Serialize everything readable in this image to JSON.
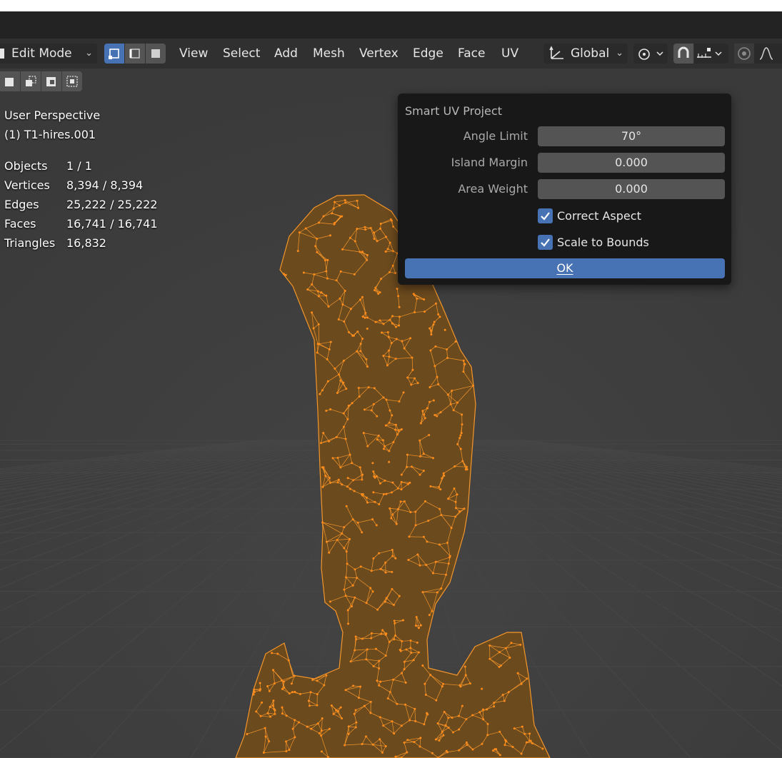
{
  "header": {
    "mode": "Edit Mode",
    "menus": [
      "View",
      "Select",
      "Add",
      "Mesh",
      "Vertex",
      "Edge",
      "Face",
      "UV"
    ],
    "pivot": "Global"
  },
  "overlay": {
    "view_name": "User Perspective",
    "object_name": "(1) T1-hires.001",
    "stats": [
      {
        "label": "Objects",
        "value": "1 / 1"
      },
      {
        "label": "Vertices",
        "value": "8,394 / 8,394"
      },
      {
        "label": "Edges",
        "value": "25,222 / 25,222"
      },
      {
        "label": "Faces",
        "value": "16,741 / 16,741"
      },
      {
        "label": "Triangles",
        "value": "16,832"
      }
    ]
  },
  "popup": {
    "title": "Smart UV Project",
    "angle_limit_label": "Angle Limit",
    "angle_limit_value": "70°",
    "island_margin_label": "Island Margin",
    "island_margin_value": "0.000",
    "area_weight_label": "Area Weight",
    "area_weight_value": "0.000",
    "correct_aspect_label": "Correct Aspect",
    "correct_aspect_checked": true,
    "scale_to_bounds_label": "Scale to Bounds",
    "scale_to_bounds_checked": true,
    "ok_label": "OK"
  },
  "colors": {
    "mesh_wire": "#f5962a",
    "mesh_fill": "#6b4a1e",
    "accent_blue": "#4772b3",
    "popup_bg": "#181818"
  }
}
